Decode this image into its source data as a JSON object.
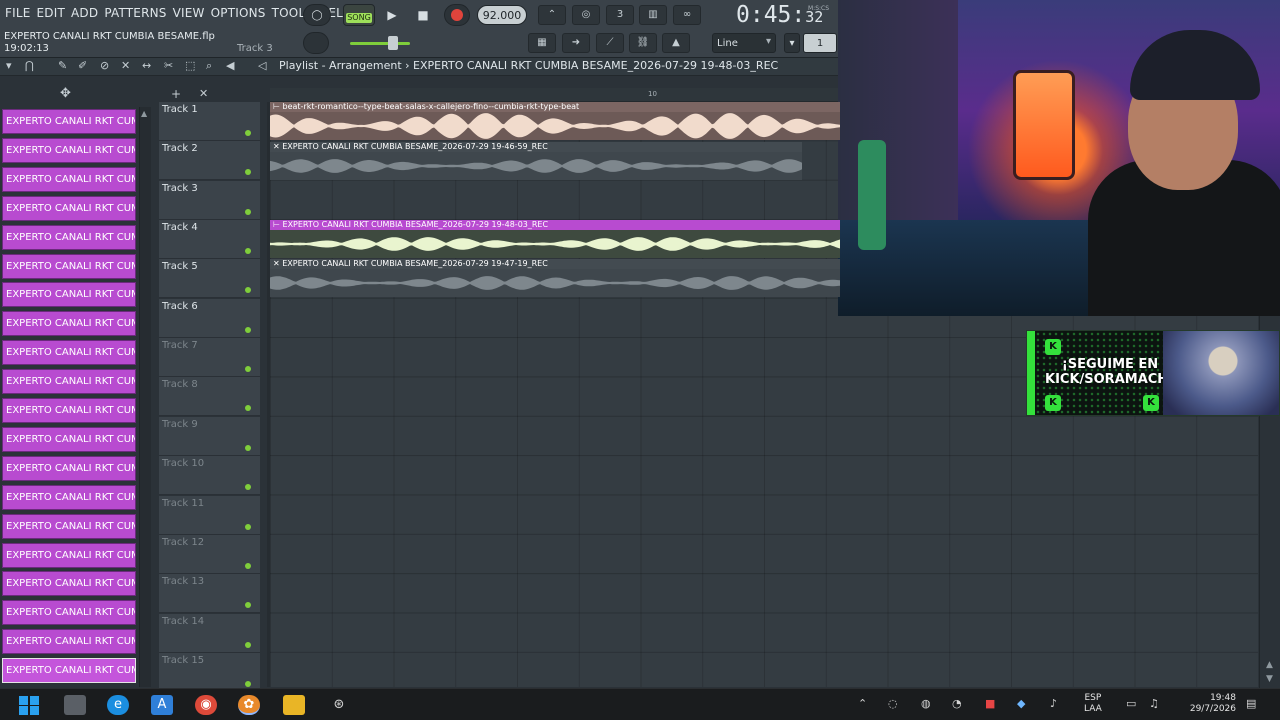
{
  "menu": [
    "FILE",
    "EDIT",
    "ADD",
    "PATTERNS",
    "VIEW",
    "OPTIONS",
    "TOOLS",
    "HELP"
  ],
  "hint": {
    "title": "EXPERTO CANALI RKT CUMBIA BESAME.flp",
    "time": "19:02:13",
    "track": "Track 3"
  },
  "transport": {
    "mode": "SONG",
    "tempo": "92.000",
    "time_main": "0:45",
    "time_sec": "32",
    "time_unit": "M:S:CS",
    "play": "▶",
    "stop": "■"
  },
  "tools": {
    "snap_mode": "Line",
    "snap_value": "1"
  },
  "playlist": {
    "title": "Playlist - Arrangement › EXPERTO CANALI RKT CUMBIA BESAME_2026-07-29 19-48-03_REC",
    "ruler_mark": "10"
  },
  "patterns": [
    "EXPERTO CANALI RKT CUM...",
    "EXPERTO CANALI RKT CUM...",
    "EXPERTO CANALI RKT CUM...",
    "EXPERTO CANALI RKT CUM...",
    "EXPERTO CANALI RKT CUM...",
    "EXPERTO CANALI RKT CUM...",
    "EXPERTO CANALI RKT CUM...",
    "EXPERTO CANALI RKT CUM...",
    "EXPERTO CANALI RKT CUM...",
    "EXPERTO CANALI RKT CUM...",
    "EXPERTO CANALI RKT CUM...",
    "EXPERTO CANALI RKT CUM...",
    "EXPERTO CANALI RKT CUM...",
    "EXPERTO CANALI RKT CUM...",
    "EXPERTO CANALI RKT CUM...",
    "EXPERTO CANALI RKT CUM...",
    "EXPERTO CANALI RKT CUM...",
    "EXPERTO CANALI RKT CUM...",
    "EXPERTO CANALI RKT CUM...",
    "EXPERTO CANALI RKT CUM..."
  ],
  "tracks": [
    "Track 1",
    "Track 2",
    "Track 3",
    "Track 4",
    "Track 5",
    "Track 6",
    "Track 7",
    "Track 8",
    "Track 9",
    "Track 10",
    "Track 11",
    "Track 12",
    "Track 13",
    "Track 14",
    "Track 15"
  ],
  "clips": [
    {
      "title": "⊢ beat-rkt-romantico--type-beat-salas-x-callejero-fino--cumbia-rkt-type-beat",
      "style": "beat"
    },
    {
      "title": "✕ EXPERTO CANALI RKT CUMBIA BESAME_2026-07-29 19-46-59_REC",
      "style": "muted"
    },
    {
      "title": "⊢ EXPERTO CANALI RKT CUMBIA BESAME_2026-07-29 19-48-03_REC",
      "style": "active"
    },
    {
      "title": "✕ EXPERTO CANALI RKT CUMBIA BESAME_2026-07-29 19-47-19_REC",
      "style": "muted"
    }
  ],
  "banner": {
    "line1": "¡SEGUIME EN",
    "line2": "KICK/SORAMACHINE!"
  },
  "taskbar": {
    "lang1": "ESP",
    "lang2": "LAA",
    "time": "19:48",
    "date": "29/7/2026"
  },
  "colors": {
    "pattern": "#b84bd0",
    "accent_green": "#7fce3b",
    "record_red": "#e0443c",
    "clip_beat": "#e8d6c8",
    "clip_active": "#d9eabf"
  }
}
